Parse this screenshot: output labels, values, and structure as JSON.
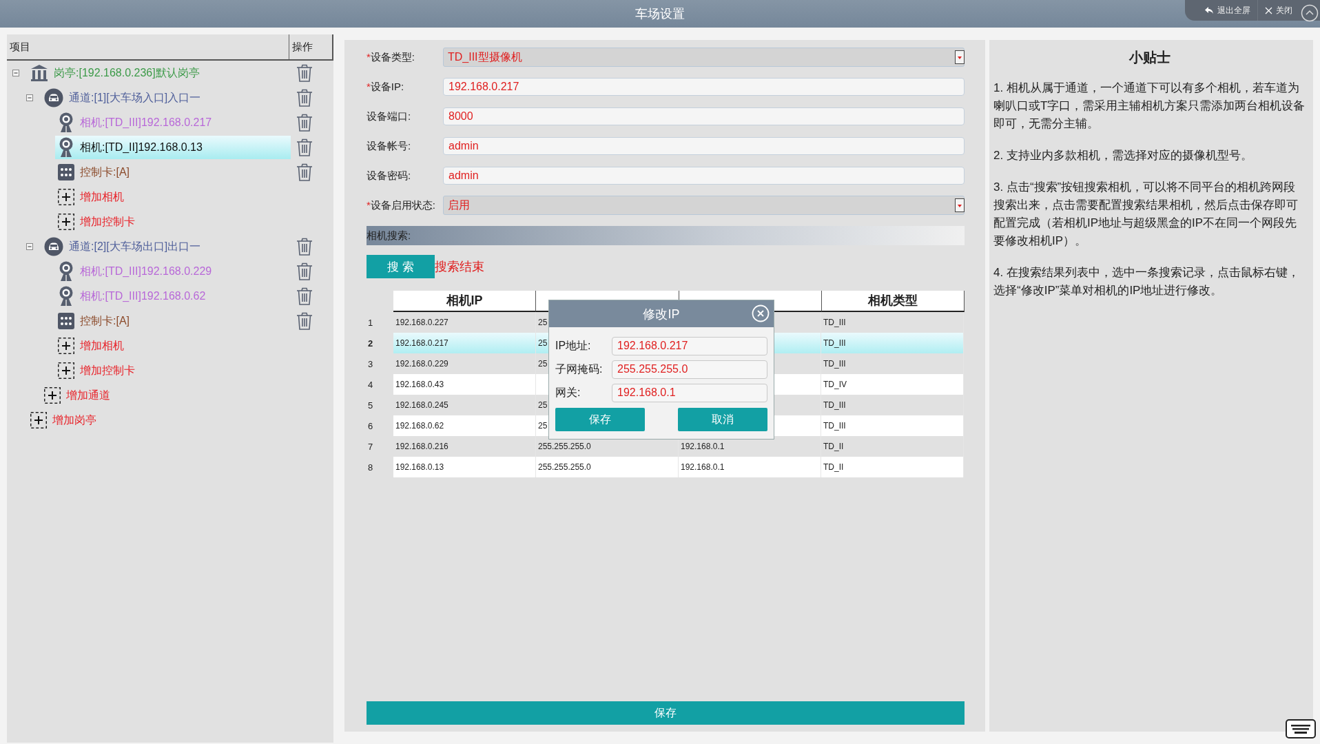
{
  "window": {
    "title": "车场设置"
  },
  "window_controls": [
    {
      "kind": "exit-fullscreen",
      "label": "退出全屏"
    },
    {
      "kind": "close",
      "label": "关闭"
    }
  ],
  "tree": {
    "columns": [
      "项目",
      "操作"
    ],
    "items": [
      {
        "kind": "booth",
        "label": "岗亭:[192.168.0.236]默认岗亭",
        "selected": false,
        "expanded": true,
        "children": [
          {
            "kind": "lane",
            "label": "通道:[1][大车场入口]入口一",
            "selected": false,
            "expanded": true,
            "children": [
              {
                "kind": "camera",
                "label": "相机:[TD_III]192.168.0.217",
                "selected": false
              },
              {
                "kind": "camera",
                "label": "相机:[TD_II]192.168.0.13",
                "selected": true
              },
              {
                "kind": "card",
                "label": "控制卡:[A]",
                "selected": false
              },
              {
                "kind": "add",
                "label": "增加相机",
                "selected": false
              },
              {
                "kind": "add",
                "label": "增加控制卡",
                "selected": false
              }
            ]
          },
          {
            "kind": "lane",
            "label": "通道:[2][大车场出口]出口一",
            "selected": false,
            "expanded": true,
            "children": [
              {
                "kind": "camera",
                "label": "相机:[TD_III]192.168.0.229",
                "selected": false
              },
              {
                "kind": "camera",
                "label": "相机:[TD_III]192.168.0.62",
                "selected": false
              },
              {
                "kind": "card",
                "label": "控制卡:[A]",
                "selected": false
              },
              {
                "kind": "add",
                "label": "增加相机",
                "selected": false
              },
              {
                "kind": "add",
                "label": "增加控制卡",
                "selected": false
              }
            ]
          },
          {
            "kind": "add",
            "label": "增加通道",
            "selected": false
          }
        ]
      },
      {
        "kind": "add",
        "label": "增加岗亭",
        "selected": false
      }
    ]
  },
  "device_form": {
    "fields": [
      {
        "kind": "select",
        "mark": "*",
        "label": "设备类型:",
        "value": "TD_III型摄像机"
      },
      {
        "kind": "text",
        "mark": "*",
        "label": "设备IP:",
        "value": "192.168.0.217"
      },
      {
        "kind": "text",
        "label": "设备端口:",
        "value": "8000"
      },
      {
        "kind": "text",
        "label": "设备帐号:",
        "value": "admin"
      },
      {
        "kind": "text",
        "label": "设备密码:",
        "value": "admin"
      },
      {
        "kind": "select",
        "mark": "*",
        "label": "设备启用状态:",
        "value": "启用"
      }
    ],
    "search_section": "相机搜索:",
    "search_button": "搜 索",
    "search_status": "搜索结束"
  },
  "search_results": {
    "columns": {
      "ip": "相机IP",
      "type": "相机类型"
    },
    "rows": [
      {
        "no": "1",
        "ip": "192.168.0.227",
        "mask": "25",
        "type": "TD_III",
        "selected": false
      },
      {
        "no": "2",
        "ip": "192.168.0.217",
        "mask": "25",
        "type": "TD_III",
        "selected": true
      },
      {
        "no": "3",
        "ip": "192.168.0.229",
        "mask": "25",
        "type": "TD_III",
        "selected": false
      },
      {
        "no": "4",
        "ip": "192.168.0.43",
        "type": "TD_IV",
        "selected": false
      },
      {
        "no": "5",
        "ip": "192.168.0.245",
        "mask": "25",
        "type": "TD_III",
        "selected": false
      },
      {
        "no": "6",
        "ip": "192.168.0.62",
        "mask": "25",
        "type": "TD_III",
        "selected": false
      },
      {
        "no": "7",
        "ip": "192.168.0.216",
        "mask": "255.255.255.0",
        "gateway": "192.168.0.1",
        "type": "TD_II",
        "selected": false
      },
      {
        "no": "8",
        "ip": "192.168.0.13",
        "mask": "255.255.255.0",
        "gateway": "192.168.0.1",
        "type": "TD_II",
        "selected": false
      }
    ]
  },
  "save_button": "保存",
  "modify_ip_dialog": {
    "title": "修改IP",
    "fields": [
      {
        "label": "IP地址:",
        "value": "192.168.0.217"
      },
      {
        "label": "子网掩码:",
        "value": "255.255.255.0"
      },
      {
        "label": "网关:",
        "value": "192.168.0.1"
      }
    ],
    "buttons": [
      "保存",
      "取消"
    ]
  },
  "tips": {
    "title": "小贴士",
    "paragraphs": [
      "1. 相机从属于通道，一个通道下可以有多个相机，若车道为喇叭口或T字口，需采用主辅相机方案只需添加两台相机设备即可，无需分主辅。",
      "2. 支持业内多款相机，需选择对应的摄像机型号。",
      "3. 点击“搜索”按钮搜索相机，可以将不同平台的相机跨网段搜索出来，点击需要配置搜索结果相机，然后点击保存即可配置完成（若相机IP地址与超级黑盒的IP不在同一个网段先要修改相机IP）。",
      "4. 在搜索结果列表中，选中一条搜索记录，点击鼠标右键，选择“修改IP”菜单对相机的IP地址进行修改。"
    ]
  }
}
